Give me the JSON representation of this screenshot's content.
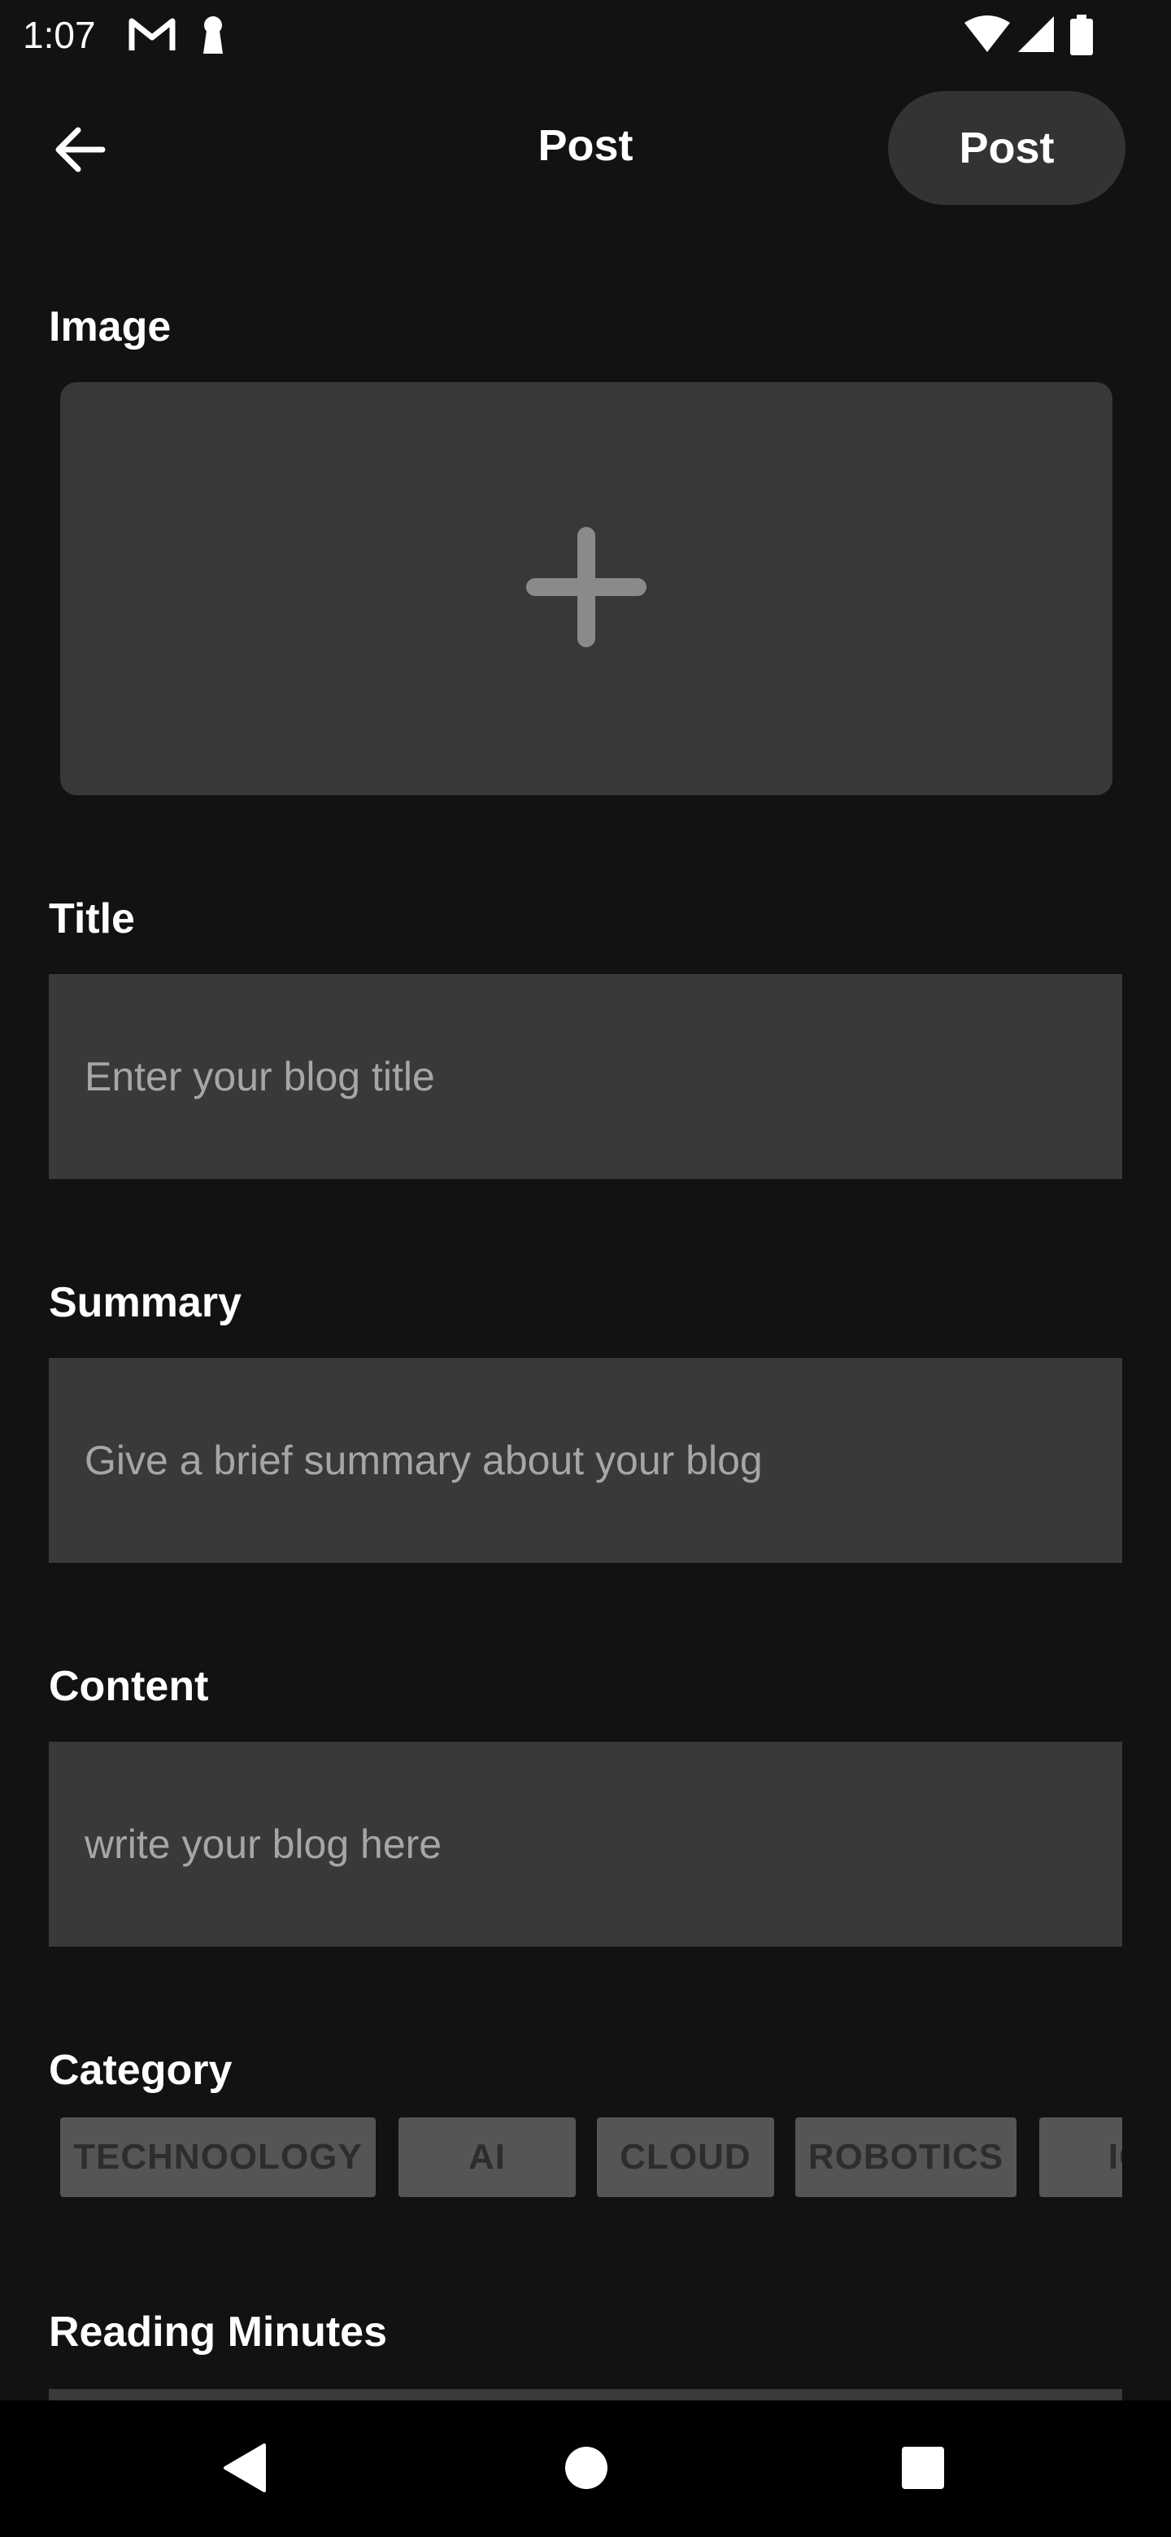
{
  "status_bar": {
    "time": "1:07",
    "icons": [
      "gmail-icon",
      "keyhole-icon",
      "wifi-icon",
      "cellular-signal-icon",
      "battery-icon"
    ]
  },
  "app_bar": {
    "title": "Post",
    "back_icon": "arrow-left-icon",
    "post_button_label": "Post"
  },
  "form": {
    "image": {
      "label": "Image",
      "add_icon": "plus-icon"
    },
    "title": {
      "label": "Title",
      "placeholder": "Enter your blog title",
      "value": ""
    },
    "summary": {
      "label": "Summary",
      "placeholder": "Give a brief summary about your blog",
      "value": ""
    },
    "content": {
      "label": "Content",
      "placeholder": "write your blog here",
      "value": ""
    },
    "category": {
      "label": "Category",
      "chips": [
        "TECHNOOLOGY",
        "AI",
        "CLOUD",
        "ROBOTICS",
        "IO"
      ]
    },
    "reading_minutes": {
      "label": "Reading Minutes"
    }
  },
  "nav_bar": {
    "back": "triangle-back-icon",
    "home": "circle-home-icon",
    "recents": "square-recents-icon"
  },
  "colors": {
    "background": "#121212",
    "field": "#393939",
    "chip": "#555555",
    "post_button": "#333333"
  }
}
